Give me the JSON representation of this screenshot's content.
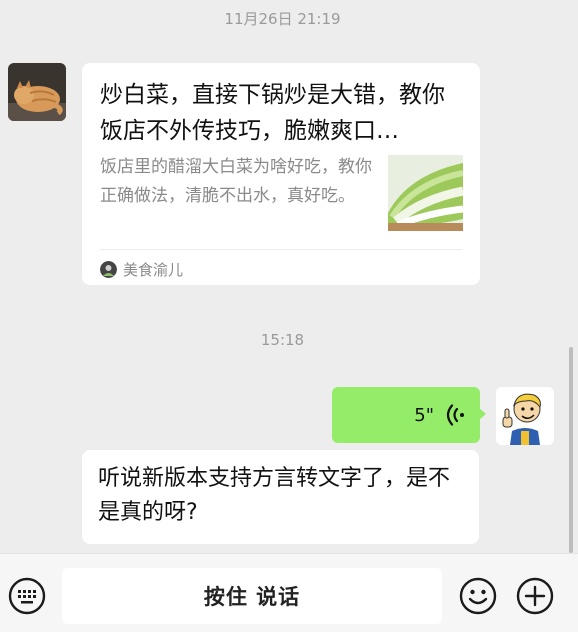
{
  "timestamps": [
    "11月26日 21:19",
    "15:18"
  ],
  "share_card": {
    "title": "炒白菜，直接下锅炒是大错，教你饭店不外传技巧，脆嫩爽口…",
    "description": "饭店里的醋溜大白菜为啥好吃，教你正确做法，清脆不出水，真好吃。",
    "source": "美食渝儿"
  },
  "voice_message": {
    "duration": "5\""
  },
  "text_message": "听说新版本支持方言转文字了，是不是真的呀?",
  "input_bar": {
    "talk_button": "按住 说话"
  },
  "colors": {
    "voice_bubble": "#95ec69",
    "background": "#ededed"
  },
  "icons": [
    "keyboard-icon",
    "emoji-icon",
    "plus-icon",
    "voice-wave-icon"
  ]
}
